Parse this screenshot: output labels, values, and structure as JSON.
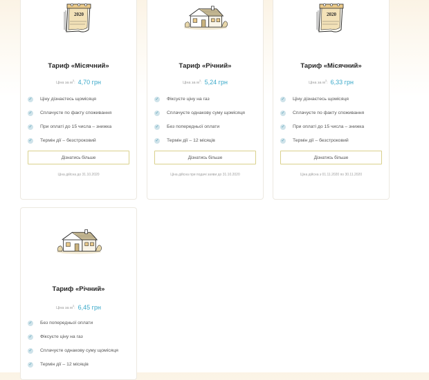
{
  "cards": [
    {
      "title": "Тариф «Місячний»",
      "price_label": "Ціна за м",
      "price_sup": "3",
      "price": "4,70 грн",
      "illustration": "calendar-icon",
      "features": [
        "Ціну дізнаєтесь щомісяця",
        "Сплачуєте по факту споживання",
        "При оплаті до 15 числа – знижка",
        "Термін дії – безстроковий"
      ],
      "button": "Дізнатись більше",
      "note": "Ціна дійсна до 31.10.2020"
    },
    {
      "title": "Тариф «Річний»",
      "price_label": "Ціна за м",
      "price_sup": "3",
      "price": "5,24 грн",
      "illustration": "house-icon",
      "features": [
        "Фіксуєте ціну на газ",
        "Сплачуєте однакову суму щомісяця",
        "Без попередньої оплати",
        "Термін дії – 12 місяців"
      ],
      "button": "Дізнатись більше",
      "note": "Ціна дійсна при подачі заяви до 31.10.2020"
    },
    {
      "title": "Тариф «Місячний»",
      "price_label": "Ціна за м",
      "price_sup": "3",
      "price": "6,33 грн",
      "illustration": "calendar-icon",
      "features": [
        "Ціну дізнаєтесь щомісяця",
        "Сплачуєте по факту споживання",
        "При оплаті до 15 числа – знижка",
        "Термін дії – безстроковий"
      ],
      "button": "Дізнатись більше",
      "note": "Ціна дійсна з 01.11.2020 по 30.11.2020"
    },
    {
      "title": "Тариф «Річний»",
      "price_label": "Ціна за м",
      "price_sup": "3",
      "price": "6,45 грн",
      "illustration": "house-icon",
      "features": [
        "Без попередньої оплати",
        "Фіксуєте ціну на газ",
        "Сплачуєте однакову суму щомісяця",
        "Термін дії – 12 місяців"
      ]
    }
  ],
  "calendar_year": "2020",
  "colors": {
    "accent": "#39a8c9",
    "button_border": "#d9d08c",
    "page_bg": "#fbf3e5"
  }
}
